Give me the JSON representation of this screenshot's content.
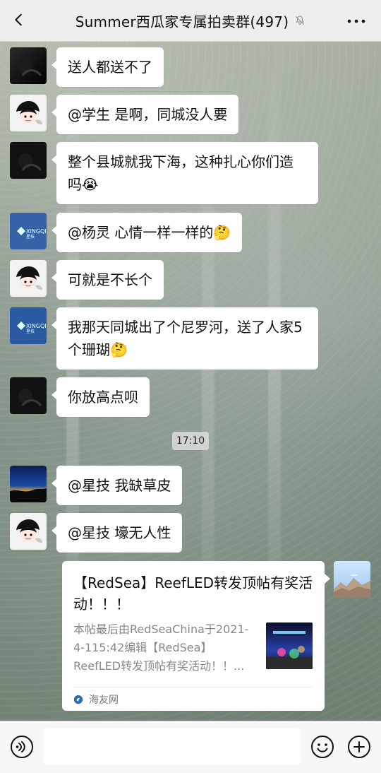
{
  "header": {
    "title": "Summer西瓜家专属拍卖群(497)",
    "back_icon": "back-chevron-icon",
    "mute_icon": "bell-mute-icon",
    "more_icon": "more-dots-icon"
  },
  "messages": [
    {
      "avatar": "avatar-dark-silhouette",
      "text": "送人都送不了"
    },
    {
      "avatar": "avatar-anime",
      "text": "@学生  是啊，同城没人要"
    },
    {
      "avatar": "avatar-dark-silhouette",
      "text": "整个县城就我下海，这种扎心你们造吗😭"
    },
    {
      "avatar": "avatar-xingqi-logo",
      "text": "@杨灵  心情一样一样的🤔"
    },
    {
      "avatar": "avatar-anime",
      "text": "可就是不长个"
    },
    {
      "avatar": "avatar-xingqi-logo",
      "text": "我那天同城出了个尼罗河，送了人家5个珊瑚🤔"
    },
    {
      "avatar": "avatar-dark-silhouette",
      "text": "你放高点呗"
    },
    {
      "avatar": "avatar-sunset",
      "text": "@星技  我缺草皮"
    },
    {
      "avatar": "avatar-anime",
      "text": "@星技  壕无人性"
    }
  ],
  "timestamp": "17:10",
  "shared_card": {
    "title": "【RedSea】ReefLED转发顶帖有奖活动！！！",
    "desc": "本帖最后由RedSeaChina于2021-4-115:42编辑【RedSea】ReefLED转发顶帖有奖活动！！...",
    "source": "海友网",
    "thumb": "aquarium-thumb",
    "sender_avatar": "avatar-mountain"
  },
  "composer": {
    "placeholder": "",
    "voice_icon": "voice-icon",
    "emoji_icon": "emoji-icon",
    "plus_icon": "plus-icon"
  }
}
